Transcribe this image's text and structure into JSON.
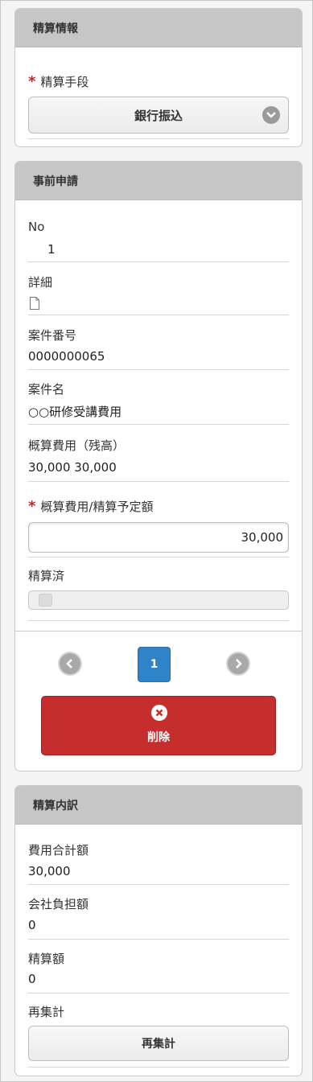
{
  "settlement_info": {
    "header": "精算情報",
    "method_label": "精算手段",
    "required_mark": "*",
    "method_value": "銀行振込",
    "select_icon": "chevron-down-icon"
  },
  "pre_application": {
    "header": "事前申請",
    "no_label": "No",
    "no_value": "1",
    "detail_label": "詳細",
    "detail_icon": "document-icon",
    "case_no_label": "案件番号",
    "case_no_value": "0000000065",
    "case_name_label": "案件名",
    "case_name_value": "○○研修受講費用",
    "estimate_label": "概算費用（残高）",
    "estimate_value": "30,000 30,000",
    "required_mark": "*",
    "planned_label": "概算費用/精算予定額",
    "planned_value": "30,000",
    "settled_label": "精算済",
    "settled_state": "off",
    "page_current": "1",
    "prev_icon": "chevron-left-icon",
    "next_icon": "chevron-right-icon",
    "delete_label": "削除",
    "delete_icon": "close-icon"
  },
  "breakdown": {
    "header": "精算内訳",
    "total_label": "費用合計額",
    "total_value": "30,000",
    "company_label": "会社負担額",
    "company_value": "0",
    "amount_label": "精算額",
    "amount_value": "0",
    "recalc_label": "再集計",
    "recalc_button": "再集計"
  },
  "colors": {
    "header_bg": "#c6c6c6",
    "required": "#d0211c",
    "page_active": "#2f83c8",
    "delete_bg": "#c62d2d"
  }
}
